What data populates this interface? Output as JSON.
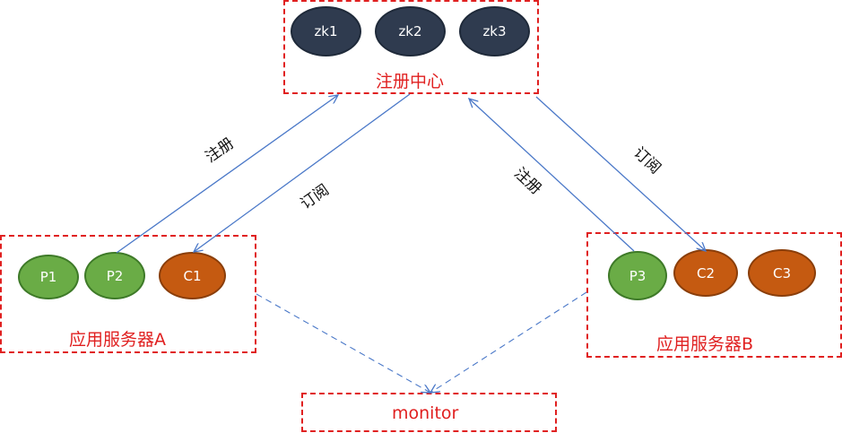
{
  "registry": {
    "label": "注册中心",
    "nodes": [
      "zk1",
      "zk2",
      "zk3"
    ]
  },
  "server_a": {
    "label": "应用服务器A",
    "providers": [
      "P1",
      "P2"
    ],
    "consumers": [
      "C1"
    ]
  },
  "server_b": {
    "label": "应用服务器B",
    "providers": [
      "P3"
    ],
    "consumers": [
      "C2",
      "C3"
    ]
  },
  "monitor": {
    "label": "monitor"
  },
  "edges": {
    "register_a": "注册",
    "subscribe_a": "订阅",
    "register_b": "注册",
    "subscribe_b": "订阅"
  },
  "colors": {
    "zk_node": "#2f3b4f",
    "provider_node": "#6aac46",
    "consumer_node": "#c55a11",
    "box_border": "#e02020",
    "arrow": "#4a78c8"
  }
}
